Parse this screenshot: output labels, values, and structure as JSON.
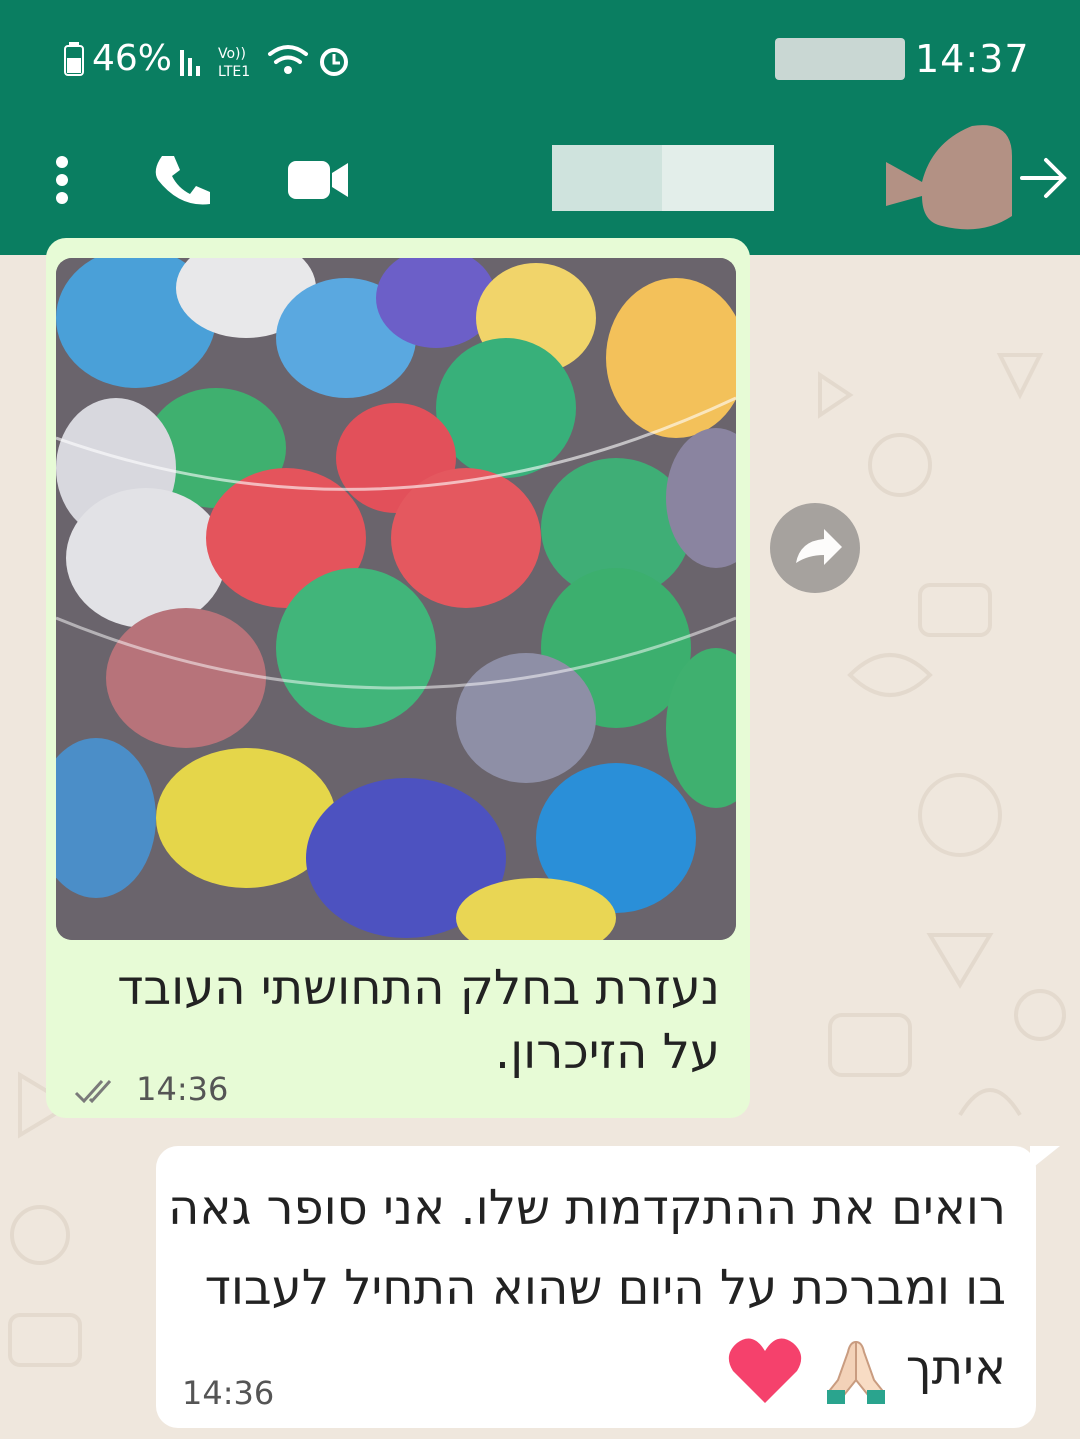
{
  "status_bar": {
    "battery_percent": "46%",
    "network_label": "LTE1",
    "clock": "14:37"
  },
  "app_bar": {
    "icons": [
      "menu-dots-icon",
      "call-icon",
      "video-call-icon",
      "back-arrow-icon"
    ],
    "accent_color": "#0a7e61"
  },
  "messages": [
    {
      "direction": "incoming",
      "has_image": true,
      "caption": "נעזרת בחלק התחושתי העובד על הזיכרון.",
      "time": "14:36",
      "status": "read"
    },
    {
      "direction": "outgoing",
      "text": "רואים את ההתקדמות שלו. אני סופר גאה בו ומברכת על היום שהוא התחיל לעבוד איתך",
      "emojis": [
        "folded-hands",
        "red-heart"
      ],
      "time": "14:36"
    }
  ],
  "colors": {
    "incoming_bubble": "#e7fbd6",
    "outgoing_bubble": "#ffffff",
    "chat_background": "#efe7dd"
  }
}
